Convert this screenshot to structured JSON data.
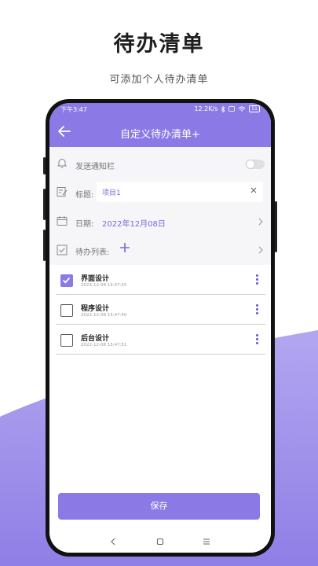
{
  "promo": {
    "title": "待办清单",
    "subtitle": "可添加个人待办清单"
  },
  "status_bar": {
    "time": "下午3:47",
    "speed": "12.2K/s",
    "battery": "51"
  },
  "app_bar": {
    "title": "自定义待办清单+"
  },
  "form": {
    "notify_label": "发送通知栏",
    "notify_enabled": false,
    "title_label": "标题:",
    "title_value": "项目1",
    "date_label": "日期:",
    "date_value": "2022年12月08日",
    "todo_list_label": "待办列表:"
  },
  "tasks": [
    {
      "name": "界面设计",
      "time": "2023-12-08 15:47:25",
      "checked": true
    },
    {
      "name": "程序设计",
      "time": "2022-12-08 15:47:40",
      "checked": false
    },
    {
      "name": "后台设计",
      "time": "2022-12-08 15:47:51",
      "checked": false
    }
  ],
  "save_label": "保存",
  "icons": {
    "back": "arrow-left-icon",
    "bell": "bell-icon",
    "edit": "edit-icon",
    "calendar": "calendar-icon",
    "checklist": "checklist-icon",
    "add": "plus-icon",
    "more": "more-vertical-icon",
    "clear": "close-icon",
    "chevron": "chevron-right-icon"
  },
  "colors": {
    "accent": "#8b7ae6",
    "accent_text": "#7a68d8",
    "wave": "#9b8ae8"
  }
}
